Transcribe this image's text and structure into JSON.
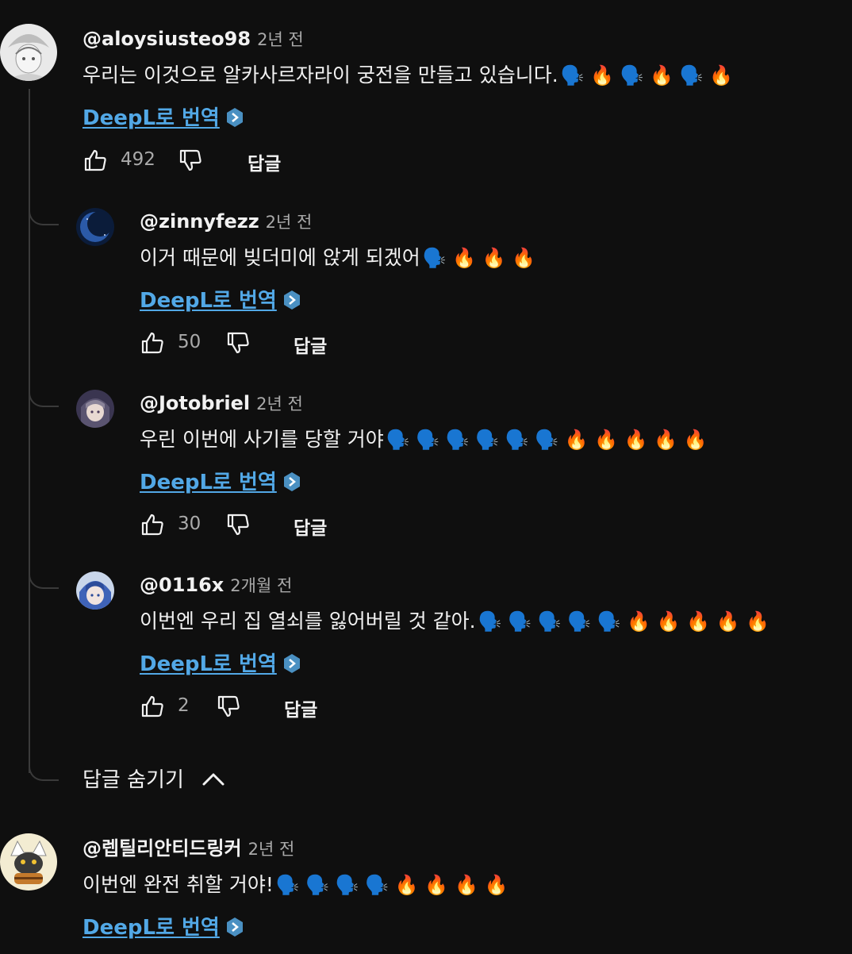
{
  "comments": [
    {
      "handle": "@aloysiusteo98",
      "time": "2년 전",
      "text": "우리는 이것으로 알카사르자라이 궁전을 만들고 있습니다.",
      "emojis": "🗣️ 🔥 🗣️ 🔥 🗣️ 🔥",
      "translate": "DeepL로 번역",
      "likes": "492",
      "reply": "답글"
    },
    {
      "handle": "@zinnyfezz",
      "time": "2년 전",
      "text": "이거 때문에 빚더미에 앉게 되겠어",
      "emojis": "🗣️ 🔥 🔥 🔥",
      "translate": "DeepL로 번역",
      "likes": "50",
      "reply": "답글"
    },
    {
      "handle": "@Jotobriel",
      "time": "2년 전",
      "text": "우린 이번에 사기를 당할 거야",
      "emojis": "🗣️ 🗣️ 🗣️ 🗣️ 🗣️ 🗣️ 🔥 🔥 🔥 🔥 🔥",
      "translate": "DeepL로 번역",
      "likes": "30",
      "reply": "답글"
    },
    {
      "handle": "@0116x",
      "time": "2개월 전",
      "text": "이번엔 우리 집 열쇠를 잃어버릴 것 같아.",
      "emojis": "🗣️ 🗣️ 🗣️ 🗣️ 🗣️ 🔥 🔥 🔥 🔥 🔥",
      "translate": "DeepL로 번역",
      "likes": "2",
      "reply": "답글"
    },
    {
      "handle": "@렙틸리안티드링커",
      "time": "2년 전",
      "text": "이번엔 완전 취할 거야!",
      "emojis": "🗣️ 🗣️ 🗣️ 🗣️ 🔥 🔥 🔥 🔥",
      "translate": "DeepL로 번역"
    }
  ],
  "hide_replies_label": "답글 숨기기",
  "colors": {
    "background": "#0f0f0f",
    "link": "#52a8e6",
    "secondary_text": "#aaaaaa",
    "thread_line": "#3a3a3a"
  }
}
